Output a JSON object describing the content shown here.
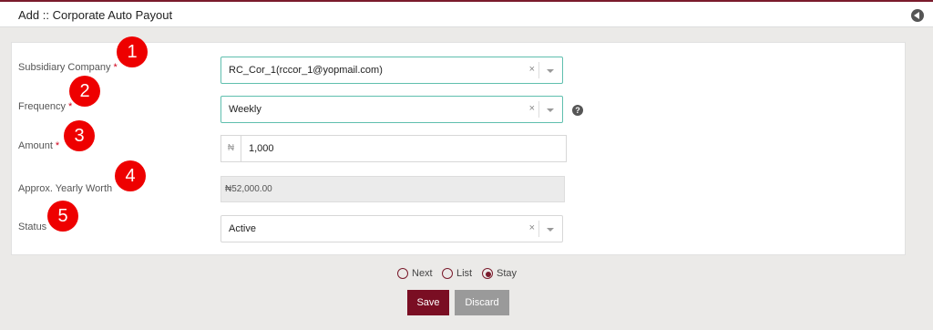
{
  "header": {
    "title": "Add :: Corporate Auto Payout"
  },
  "form": {
    "subsidiary": {
      "label": "Subsidiary Company",
      "required": "*",
      "value": "RC_Cor_1(rccor_1@yopmail.com)",
      "clear": "×"
    },
    "frequency": {
      "label": "Frequency",
      "required": "*",
      "value": "Weekly",
      "clear": "×",
      "help": "?"
    },
    "amount": {
      "label": "Amount",
      "required": "*",
      "prefix": "₦",
      "value": "1,000"
    },
    "yearly": {
      "label": "Approx. Yearly Worth",
      "value": "₦52,000.00"
    },
    "status": {
      "label": "Status",
      "value": "Active",
      "clear": "×"
    }
  },
  "badges": [
    "1",
    "2",
    "3",
    "4",
    "5"
  ],
  "after_save": {
    "options": [
      "Next",
      "List",
      "Stay"
    ],
    "selected": "Stay"
  },
  "buttons": {
    "save": "Save",
    "discard": "Discard"
  },
  "colors": {
    "brand": "#7a0e23",
    "focus": "#5fbfae",
    "badge": "#ee0000"
  }
}
